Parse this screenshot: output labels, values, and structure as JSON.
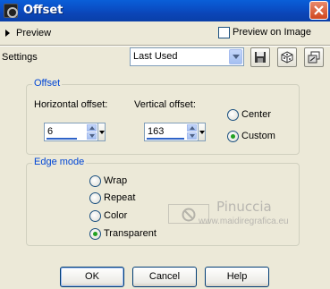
{
  "window": {
    "title": "Offset",
    "title_icon": "app-icon",
    "close_icon": "close-icon"
  },
  "preview": {
    "toggle_label": "Preview",
    "preview_on_image_label": "Preview on Image",
    "preview_on_image_checked": false
  },
  "settings": {
    "label": "Settings",
    "preset_value": "Last Used",
    "tool_icons": [
      "save-icon",
      "randomize-dice-icon",
      "reset-icon"
    ]
  },
  "offset_group": {
    "title": "Offset",
    "horizontal_label": "Horizontal offset:",
    "horizontal_value": "6",
    "vertical_label": "Vertical offset:",
    "vertical_value": "163",
    "origin_options": [
      {
        "label": "Center",
        "selected": false
      },
      {
        "label": "Custom",
        "selected": true
      }
    ]
  },
  "edge_group": {
    "title": "Edge mode",
    "options": [
      {
        "label": "Wrap",
        "selected": false
      },
      {
        "label": "Repeat",
        "selected": false
      },
      {
        "label": "Color",
        "selected": false
      },
      {
        "label": "Transparent",
        "selected": true
      }
    ]
  },
  "watermark": {
    "name": "Pinuccia",
    "url": "www.maidiregrafica.eu"
  },
  "buttons": {
    "ok": "OK",
    "cancel": "Cancel",
    "help": "Help"
  },
  "colors": {
    "titlebar": "#0a4fc6",
    "dialog_bg": "#ece9d8",
    "group_title": "#0046d5",
    "close_button": "#d0461e",
    "radio_selected": "#21a121"
  }
}
